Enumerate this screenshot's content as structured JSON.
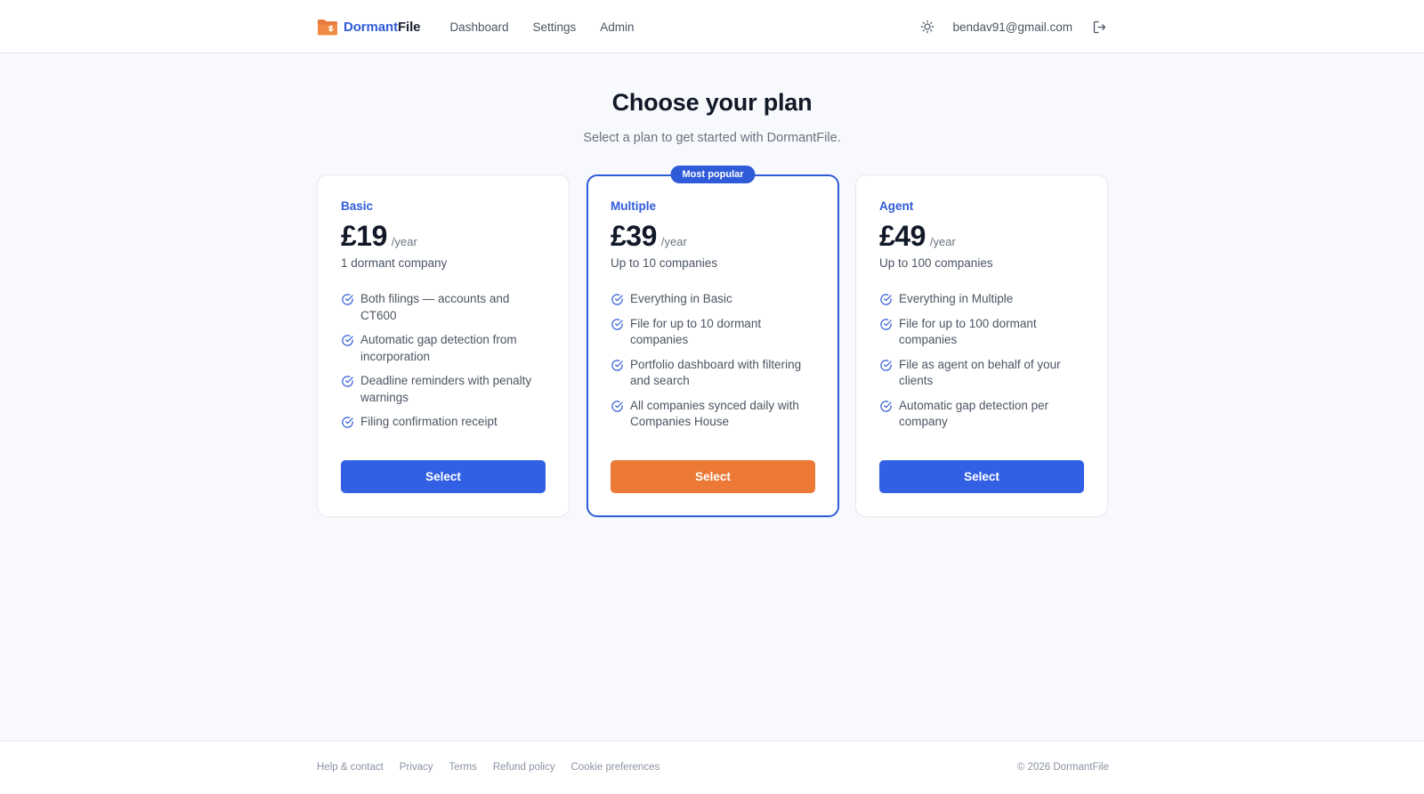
{
  "header": {
    "brand": {
      "part1": "Dormant",
      "part2": "File",
      "logo_icon": "folder-logo-icon"
    },
    "nav": [
      {
        "label": "Dashboard"
      },
      {
        "label": "Settings"
      },
      {
        "label": "Admin"
      }
    ],
    "theme_icon": "sun-icon",
    "user_email": "bendav91@gmail.com",
    "logout_icon": "logout-icon"
  },
  "main": {
    "title": "Choose your plan",
    "subtitle": "Select a plan to get started with DormantFile."
  },
  "plans": [
    {
      "name": "Basic",
      "price": "£19",
      "period": "/year",
      "subtitle": "1 dormant company",
      "features": [
        "Both filings — accounts and CT600",
        "Automatic gap detection from incorporation",
        "Deadline reminders with penalty warnings",
        "Filing confirmation receipt"
      ],
      "button_label": "Select"
    },
    {
      "name": "Multiple",
      "badge": "Most popular",
      "price": "£39",
      "period": "/year",
      "subtitle": "Up to 10 companies",
      "features": [
        "Everything in Basic",
        "File for up to 10 dormant companies",
        "Portfolio dashboard with filtering and search",
        "All companies synced daily with Companies House"
      ],
      "button_label": "Select"
    },
    {
      "name": "Agent",
      "price": "£49",
      "period": "/year",
      "subtitle": "Up to 100 companies",
      "features": [
        "Everything in Multiple",
        "File for up to 100 dormant companies",
        "File as agent on behalf of your clients",
        "Automatic gap detection per company"
      ],
      "button_label": "Select"
    }
  ],
  "footer": {
    "links": [
      {
        "label": "Help & contact"
      },
      {
        "label": "Privacy"
      },
      {
        "label": "Terms"
      },
      {
        "label": "Refund policy"
      },
      {
        "label": "Cookie preferences"
      }
    ],
    "copyright": "© 2026 DormantFile"
  },
  "colors": {
    "accent_blue": "#2f5bd8",
    "button_blue": "#3260e4",
    "button_orange": "#ec7935",
    "logo_orange": "#e9793a",
    "text_dark": "#111827",
    "text_muted": "#6b7280",
    "background": "#f7f9fc"
  }
}
